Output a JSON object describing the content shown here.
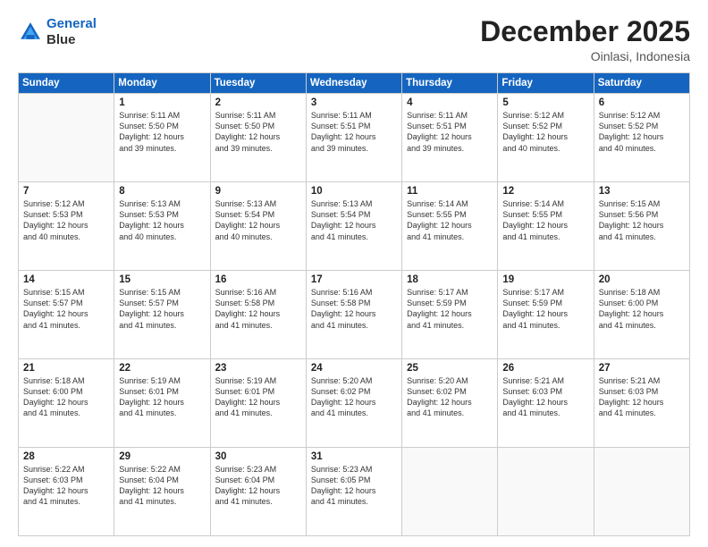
{
  "logo": {
    "line1": "General",
    "line2": "Blue"
  },
  "title": "December 2025",
  "location": "Oinlasi, Indonesia",
  "weekdays": [
    "Sunday",
    "Monday",
    "Tuesday",
    "Wednesday",
    "Thursday",
    "Friday",
    "Saturday"
  ],
  "weeks": [
    [
      {
        "day": "",
        "info": ""
      },
      {
        "day": "1",
        "info": "Sunrise: 5:11 AM\nSunset: 5:50 PM\nDaylight: 12 hours\nand 39 minutes."
      },
      {
        "day": "2",
        "info": "Sunrise: 5:11 AM\nSunset: 5:50 PM\nDaylight: 12 hours\nand 39 minutes."
      },
      {
        "day": "3",
        "info": "Sunrise: 5:11 AM\nSunset: 5:51 PM\nDaylight: 12 hours\nand 39 minutes."
      },
      {
        "day": "4",
        "info": "Sunrise: 5:11 AM\nSunset: 5:51 PM\nDaylight: 12 hours\nand 39 minutes."
      },
      {
        "day": "5",
        "info": "Sunrise: 5:12 AM\nSunset: 5:52 PM\nDaylight: 12 hours\nand 40 minutes."
      },
      {
        "day": "6",
        "info": "Sunrise: 5:12 AM\nSunset: 5:52 PM\nDaylight: 12 hours\nand 40 minutes."
      }
    ],
    [
      {
        "day": "7",
        "info": "Sunrise: 5:12 AM\nSunset: 5:53 PM\nDaylight: 12 hours\nand 40 minutes."
      },
      {
        "day": "8",
        "info": "Sunrise: 5:13 AM\nSunset: 5:53 PM\nDaylight: 12 hours\nand 40 minutes."
      },
      {
        "day": "9",
        "info": "Sunrise: 5:13 AM\nSunset: 5:54 PM\nDaylight: 12 hours\nand 40 minutes."
      },
      {
        "day": "10",
        "info": "Sunrise: 5:13 AM\nSunset: 5:54 PM\nDaylight: 12 hours\nand 41 minutes."
      },
      {
        "day": "11",
        "info": "Sunrise: 5:14 AM\nSunset: 5:55 PM\nDaylight: 12 hours\nand 41 minutes."
      },
      {
        "day": "12",
        "info": "Sunrise: 5:14 AM\nSunset: 5:55 PM\nDaylight: 12 hours\nand 41 minutes."
      },
      {
        "day": "13",
        "info": "Sunrise: 5:15 AM\nSunset: 5:56 PM\nDaylight: 12 hours\nand 41 minutes."
      }
    ],
    [
      {
        "day": "14",
        "info": "Sunrise: 5:15 AM\nSunset: 5:57 PM\nDaylight: 12 hours\nand 41 minutes."
      },
      {
        "day": "15",
        "info": "Sunrise: 5:15 AM\nSunset: 5:57 PM\nDaylight: 12 hours\nand 41 minutes."
      },
      {
        "day": "16",
        "info": "Sunrise: 5:16 AM\nSunset: 5:58 PM\nDaylight: 12 hours\nand 41 minutes."
      },
      {
        "day": "17",
        "info": "Sunrise: 5:16 AM\nSunset: 5:58 PM\nDaylight: 12 hours\nand 41 minutes."
      },
      {
        "day": "18",
        "info": "Sunrise: 5:17 AM\nSunset: 5:59 PM\nDaylight: 12 hours\nand 41 minutes."
      },
      {
        "day": "19",
        "info": "Sunrise: 5:17 AM\nSunset: 5:59 PM\nDaylight: 12 hours\nand 41 minutes."
      },
      {
        "day": "20",
        "info": "Sunrise: 5:18 AM\nSunset: 6:00 PM\nDaylight: 12 hours\nand 41 minutes."
      }
    ],
    [
      {
        "day": "21",
        "info": "Sunrise: 5:18 AM\nSunset: 6:00 PM\nDaylight: 12 hours\nand 41 minutes."
      },
      {
        "day": "22",
        "info": "Sunrise: 5:19 AM\nSunset: 6:01 PM\nDaylight: 12 hours\nand 41 minutes."
      },
      {
        "day": "23",
        "info": "Sunrise: 5:19 AM\nSunset: 6:01 PM\nDaylight: 12 hours\nand 41 minutes."
      },
      {
        "day": "24",
        "info": "Sunrise: 5:20 AM\nSunset: 6:02 PM\nDaylight: 12 hours\nand 41 minutes."
      },
      {
        "day": "25",
        "info": "Sunrise: 5:20 AM\nSunset: 6:02 PM\nDaylight: 12 hours\nand 41 minutes."
      },
      {
        "day": "26",
        "info": "Sunrise: 5:21 AM\nSunset: 6:03 PM\nDaylight: 12 hours\nand 41 minutes."
      },
      {
        "day": "27",
        "info": "Sunrise: 5:21 AM\nSunset: 6:03 PM\nDaylight: 12 hours\nand 41 minutes."
      }
    ],
    [
      {
        "day": "28",
        "info": "Sunrise: 5:22 AM\nSunset: 6:03 PM\nDaylight: 12 hours\nand 41 minutes."
      },
      {
        "day": "29",
        "info": "Sunrise: 5:22 AM\nSunset: 6:04 PM\nDaylight: 12 hours\nand 41 minutes."
      },
      {
        "day": "30",
        "info": "Sunrise: 5:23 AM\nSunset: 6:04 PM\nDaylight: 12 hours\nand 41 minutes."
      },
      {
        "day": "31",
        "info": "Sunrise: 5:23 AM\nSunset: 6:05 PM\nDaylight: 12 hours\nand 41 minutes."
      },
      {
        "day": "",
        "info": ""
      },
      {
        "day": "",
        "info": ""
      },
      {
        "day": "",
        "info": ""
      }
    ]
  ]
}
